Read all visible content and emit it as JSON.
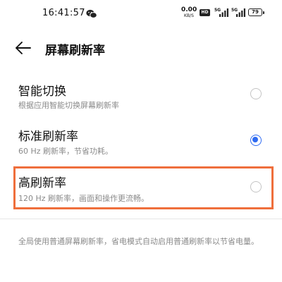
{
  "status_bar": {
    "time": "16:41:57",
    "net_speed_value": "0.00",
    "net_speed_unit": "KB/S",
    "hd_badge": "HD",
    "signal_1_tag": "5G",
    "signal_2_tag": "5G",
    "battery_level": "79",
    "icons": [
      "wechat-icon",
      "hd-icon",
      "signal-icon",
      "signal-icon",
      "battery-icon"
    ]
  },
  "header": {
    "back_icon": "back-arrow-icon",
    "title": "屏幕刷新率"
  },
  "options": [
    {
      "label": "智能切换",
      "description": "根据应用智能切换屏幕刷新率",
      "selected": false
    },
    {
      "label": "标准刷新率",
      "description": "60 Hz 刷新率，节省功耗。",
      "selected": true
    },
    {
      "label": "高刷新率",
      "description": "120 Hz 刷新率，画面和操作更流畅。",
      "selected": false
    }
  ],
  "footnote": "全局使用普通屏幕刷新率，省电模式自动启用普通刷新率以节省电量。",
  "colors": {
    "accent": "#2f6bf2",
    "highlight": "#ef6f3c",
    "secondary_text": "#8a8a8a"
  }
}
